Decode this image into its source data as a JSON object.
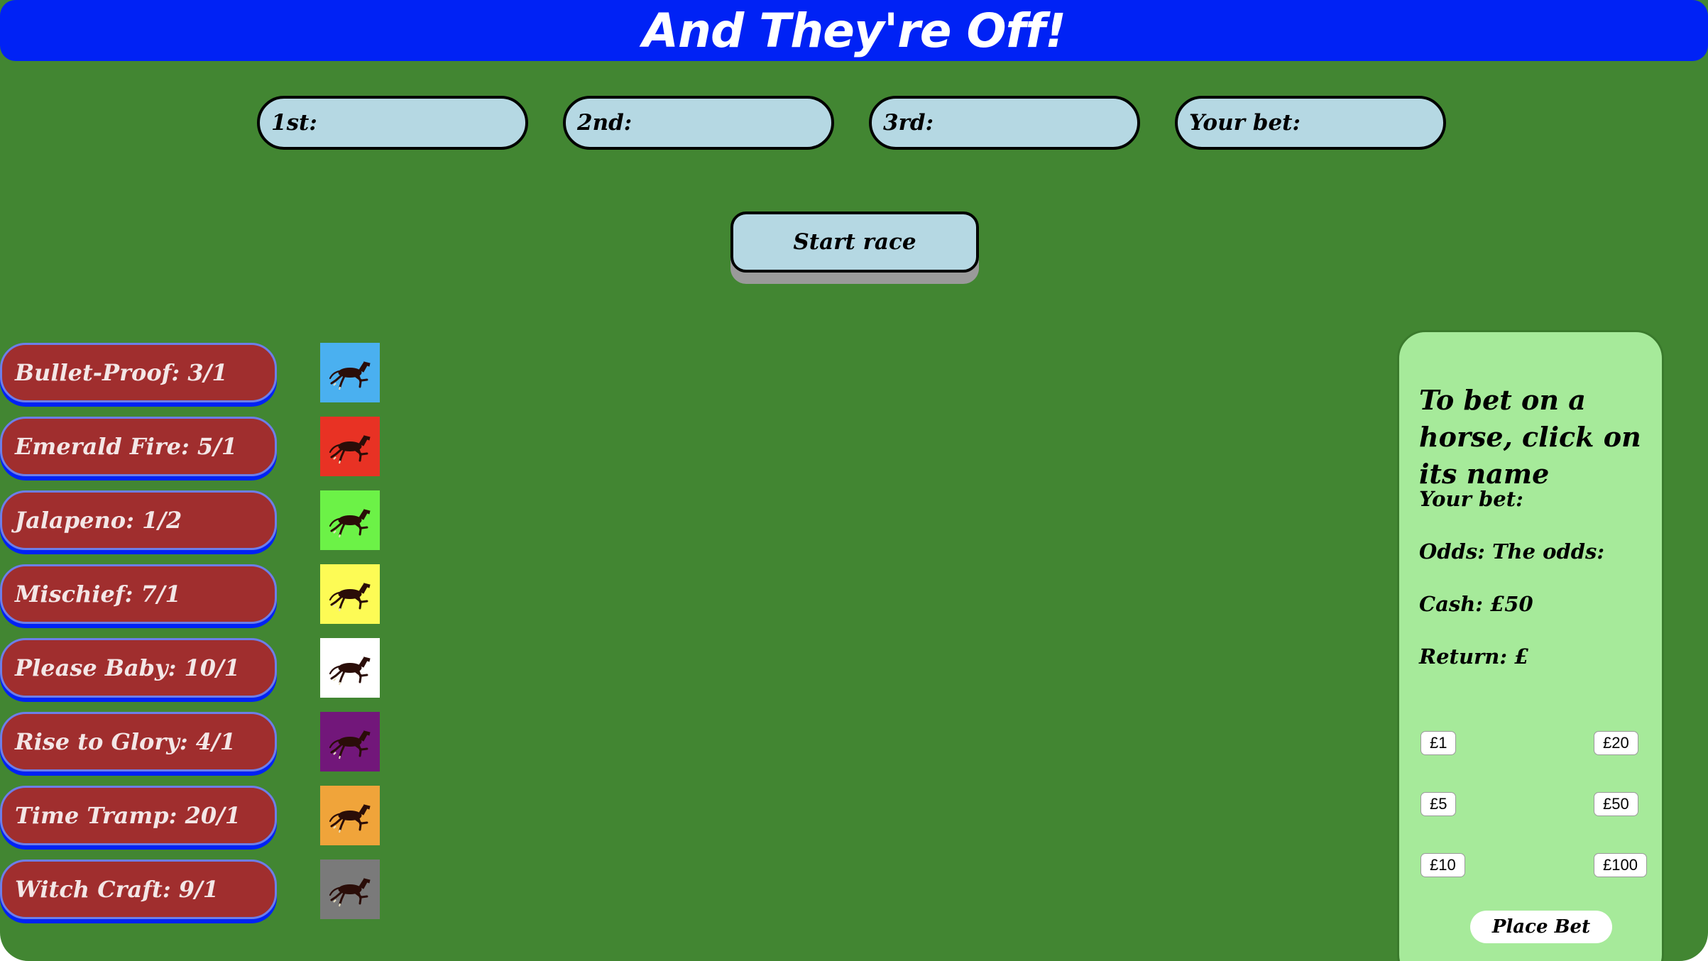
{
  "header": {
    "title": "And They're Off!"
  },
  "results": {
    "first": "1st:",
    "second": "2nd:",
    "third": "3rd:",
    "your_bet": "Your bet:"
  },
  "start_button": "Start race",
  "horses": [
    {
      "label": "Bullet-Proof: 3/1",
      "color": "#4ab0f0"
    },
    {
      "label": "Emerald Fire: 5/1",
      "color": "#e83224"
    },
    {
      "label": "Jalapeno: 1/2",
      "color": "#6cf247"
    },
    {
      "label": "Mischief: 7/1",
      "color": "#fdfb55"
    },
    {
      "label": "Please Baby: 10/1",
      "color": "#ffffff"
    },
    {
      "label": "Rise to Glory: 4/1",
      "color": "#72177a"
    },
    {
      "label": "Time Tramp: 20/1",
      "color": "#f0a43a"
    },
    {
      "label": "Witch Craft: 9/1",
      "color": "#7a7a7a"
    }
  ],
  "bet_panel": {
    "heading": "To bet on a horse, click on its name",
    "your_bet": "Your bet:",
    "odds": "Odds: The odds:",
    "cash": "Cash: £50",
    "return": "Return: £",
    "amounts": [
      "£1",
      "£20",
      "£5",
      "£50",
      "£10",
      "£100"
    ],
    "place_bet": "Place Bet"
  },
  "colors": {
    "title_bar": "#0022f5",
    "field": "#428632",
    "result_box": "#b5d8e3",
    "horse_button": "#a02e2e",
    "panel": "#a6ea9a"
  },
  "icons": {
    "horse": "horse-icon"
  }
}
